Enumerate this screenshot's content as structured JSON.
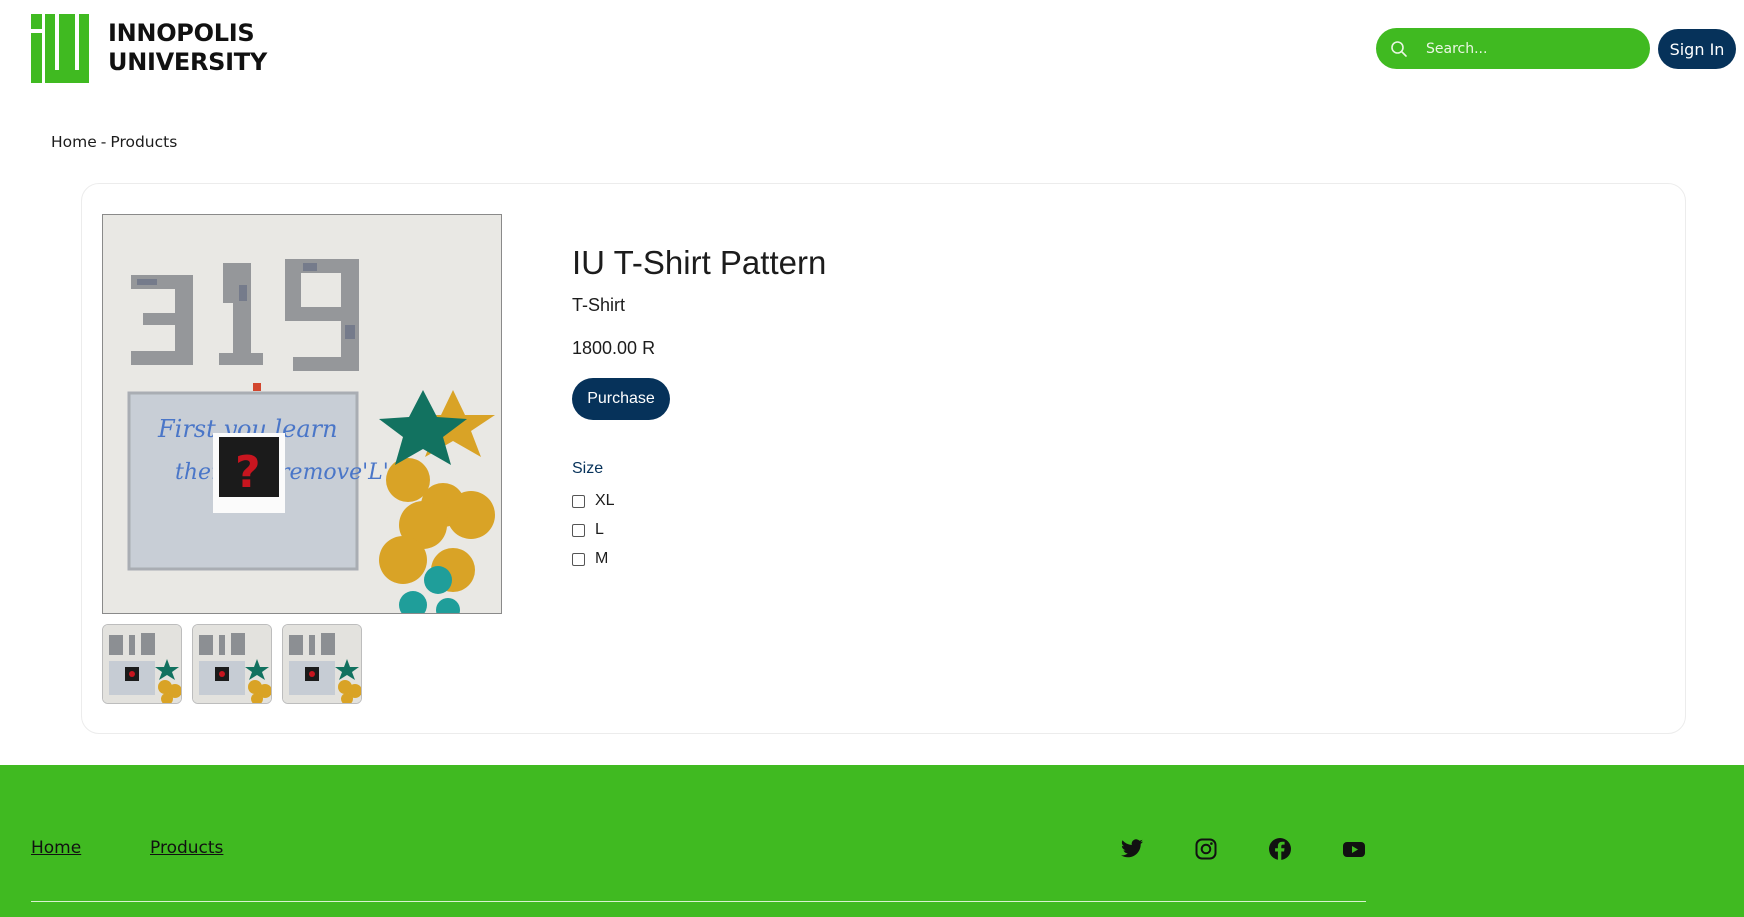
{
  "header": {
    "logo_icon": "innopolis-iu-logo",
    "logo_line1": "INNOPOLIS",
    "logo_line2": "UNIVERSITY",
    "search_placeholder": "Search...",
    "signin_label": "Sign In"
  },
  "breadcrumb": {
    "home": "Home",
    "separator": "-",
    "current": "Products"
  },
  "product": {
    "title": "IU T-Shirt Pattern",
    "category": "T-Shirt",
    "price": "1800.00 R",
    "purchase_label": "Purchase",
    "image_subject": "photo of wall with 319 collage, whiteboard, balloons",
    "thumbnail_count": 3,
    "size_label": "Size",
    "sizes": [
      {
        "label": "XL",
        "checked": false
      },
      {
        "label": "L",
        "checked": false
      },
      {
        "label": "M",
        "checked": false
      }
    ]
  },
  "footer": {
    "links": [
      "Home",
      "Products"
    ],
    "social_icons": [
      "twitter-icon",
      "instagram-icon",
      "facebook-icon",
      "youtube-icon"
    ]
  },
  "colors": {
    "brand_green": "#40ba21",
    "navy": "#06325a",
    "white": "#ffffff"
  }
}
